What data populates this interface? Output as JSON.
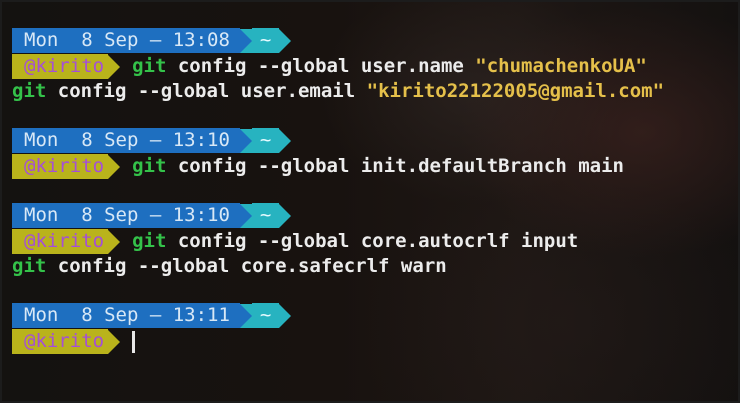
{
  "prompt": {
    "user": "@kirito",
    "dir": "~"
  },
  "blocks": [
    {
      "datetime": "Mon  8 Sep – 13:08",
      "lines": [
        {
          "cmd": "git",
          "args": " config --global user.name ",
          "str": "\"chumachenkoUA\""
        },
        {
          "cmd": "git",
          "args": " config --global user.email ",
          "str": "\"kirito22122005@gmail.com\""
        }
      ]
    },
    {
      "datetime": "Mon  8 Sep – 13:10",
      "lines": [
        {
          "cmd": "git",
          "args": " config --global init.defaultBranch main",
          "str": ""
        }
      ]
    },
    {
      "datetime": "Mon  8 Sep – 13:10",
      "lines": [
        {
          "cmd": "git",
          "args": " config --global core.autocrlf input",
          "str": ""
        },
        {
          "cmd": "git",
          "args": " config --global core.safecrlf warn",
          "str": ""
        }
      ]
    },
    {
      "datetime": "Mon  8 Sep – 13:11",
      "lines": []
    }
  ],
  "colors": {
    "date_segment": "#1e6fc0",
    "dir_segment": "#27b3c0",
    "user_segment": "#b9b31b",
    "user_text": "#a54fd6",
    "command": "#34c24a",
    "string": "#e5c04a"
  }
}
